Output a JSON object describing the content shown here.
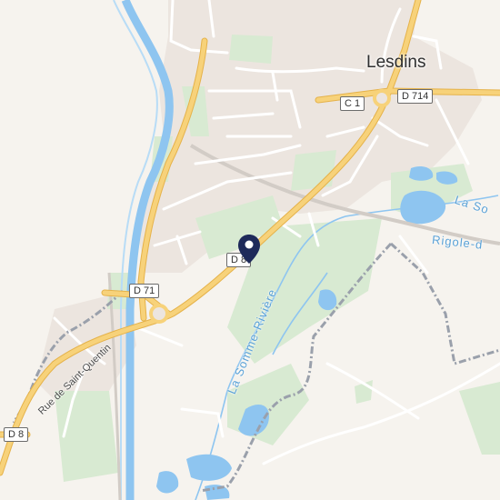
{
  "place": {
    "town": "Lesdins"
  },
  "roads": {
    "c1": "C 1",
    "d714": "D 714",
    "d8_east": "D 8",
    "d71": "D 71",
    "d8_west": "D 8",
    "rue_saint_quentin": "Rue de Saint-Quentin"
  },
  "waterways": {
    "la_somme_riviere": "La Somme-Rivière",
    "la_somme_edge": "La So",
    "rigole": "Rigole-d"
  },
  "colors": {
    "background": "#f6f3ee",
    "built_up": "#ece5df",
    "green": "#d8ead2",
    "water": "#8ec5f0",
    "road_major": "#f7d27a",
    "road_major_casing": "#e5b24a",
    "road_minor": "#ffffff",
    "boundary": "#9aa0ab",
    "pin": "#1e2a5a"
  },
  "icons": {
    "pin": "map-marker-icon"
  }
}
